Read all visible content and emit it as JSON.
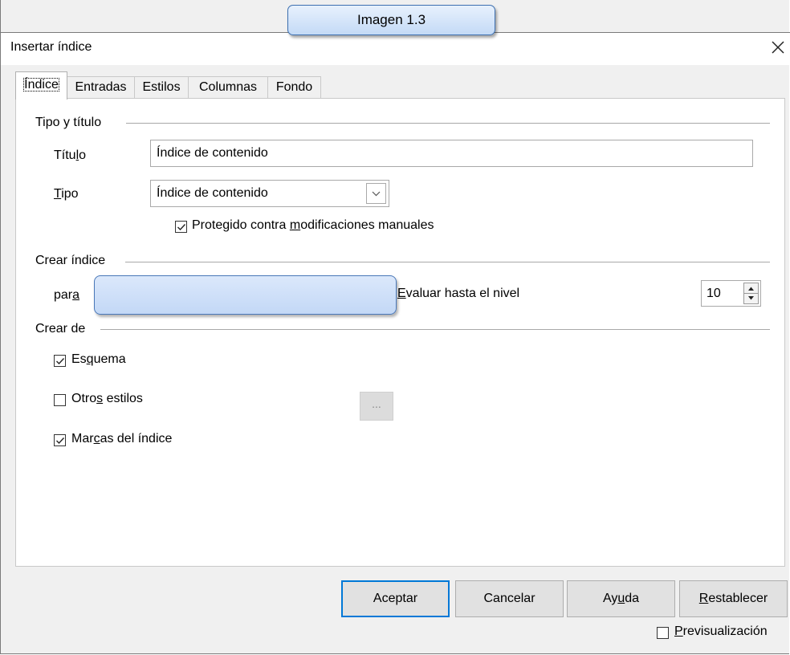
{
  "callout": {
    "text": "Imagen 1.3"
  },
  "window": {
    "title": "Insertar índice"
  },
  "tabs": [
    "Índice",
    "Entradas",
    "Estilos",
    "Columnas",
    "Fondo"
  ],
  "tipo_titulo": {
    "section": "Tipo y título",
    "titulo_label_pre": "Títu",
    "titulo_label_u": "l",
    "titulo_label_post": "o",
    "titulo_value": "Índice de contenido",
    "tipo_label_u": "T",
    "tipo_label_post": "ipo",
    "tipo_value": "Índice de contenido",
    "protegido_pre": "Protegido contra ",
    "protegido_u": "m",
    "protegido_post": "odificaciones manuales",
    "protegido_checked": true
  },
  "crear_indice": {
    "section": "Crear índice",
    "para_pre": "par",
    "para_u": "a",
    "evaluar_u": "E",
    "evaluar_post": "valuar hasta el nivel",
    "nivel_value": "10"
  },
  "crear_de": {
    "section": "Crear de",
    "esquema_pre": "Es",
    "esquema_u": "q",
    "esquema_post": "uema",
    "esquema_checked": true,
    "otros_pre": "Otro",
    "otros_u": "s",
    "otros_post": " estilos",
    "otros_checked": false,
    "dots_label": "...",
    "marcas_pre": "Mar",
    "marcas_u": "c",
    "marcas_post": "as del índice",
    "marcas_checked": true
  },
  "buttons": {
    "aceptar": "Aceptar",
    "cancelar": "Cancelar",
    "ayuda_pre": "Ay",
    "ayuda_u": "u",
    "ayuda_post": "da",
    "restablecer_u": "R",
    "restablecer_post": "establecer"
  },
  "preview": {
    "label_u": "P",
    "label_post": "revisualización",
    "checked": false
  }
}
